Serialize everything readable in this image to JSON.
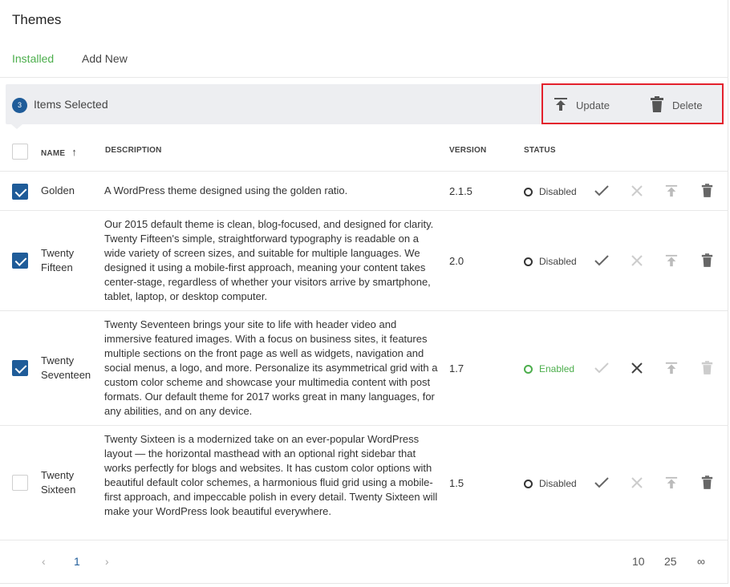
{
  "page": {
    "title": "Themes"
  },
  "tabs": {
    "installed": "Installed",
    "add_new": "Add New"
  },
  "bulk": {
    "count": "3",
    "selected_label": "Items Selected",
    "update_label": "Update",
    "delete_label": "Delete"
  },
  "table": {
    "headers": {
      "name": "NAME",
      "sort_indicator": "↑",
      "description": "DESCRIPTION",
      "version": "VERSION",
      "status": "STATUS"
    },
    "rows": [
      {
        "name_line1": "Golden",
        "name_line2": "",
        "description": "A WordPress theme designed using the golden ratio.",
        "version": "2.1.5",
        "status": "Disabled",
        "checked": true
      },
      {
        "name_line1": "Twenty",
        "name_line2": "Fifteen",
        "description": "Our 2015 default theme is clean, blog-focused, and designed for clarity. Twenty Fifteen's simple, straightforward typography is readable on a wide variety of screen sizes, and suitable for multiple languages. We designed it using a mobile-first approach, meaning your content takes center-stage, regardless of whether your visitors arrive by smartphone, tablet, laptop, or desktop computer.",
        "version": "2.0",
        "status": "Disabled",
        "checked": true
      },
      {
        "name_line1": "Twenty",
        "name_line2": "Seventeen",
        "description": "Twenty Seventeen brings your site to life with header video and immersive featured images. With a focus on business sites, it features multiple sections on the front page as well as widgets, navigation and social menus, a logo, and more. Personalize its asymmetrical grid with a custom color scheme and showcase your multimedia content with post formats. Our default theme for 2017 works great in many languages, for any abilities, and on any device.",
        "version": "1.7",
        "status": "Enabled",
        "checked": true
      },
      {
        "name_line1": "Twenty",
        "name_line2": "Sixteen",
        "description": "Twenty Sixteen is a modernized take on an ever-popular WordPress layout — the horizontal masthead with an optional right sidebar that works perfectly for blogs and websites. It has custom color options with beautiful default color schemes, a harmonious fluid grid using a mobile-first approach, and impeccable polish in every detail. Twenty Sixteen will make your WordPress look beautiful everywhere.",
        "version": "1.5",
        "status": "Disabled",
        "checked": false
      }
    ]
  },
  "pagination": {
    "prev": "‹",
    "current": "1",
    "next": "›",
    "per_page": [
      "10",
      "25",
      "∞"
    ]
  },
  "icons": {
    "upload": "upload-icon",
    "trash": "trash-icon",
    "check": "check-icon",
    "close": "close-icon"
  },
  "colors": {
    "accent": "#1f5c99",
    "enabled": "#4cae4c",
    "highlight": "#e3202c",
    "bar": "#edeef1"
  }
}
